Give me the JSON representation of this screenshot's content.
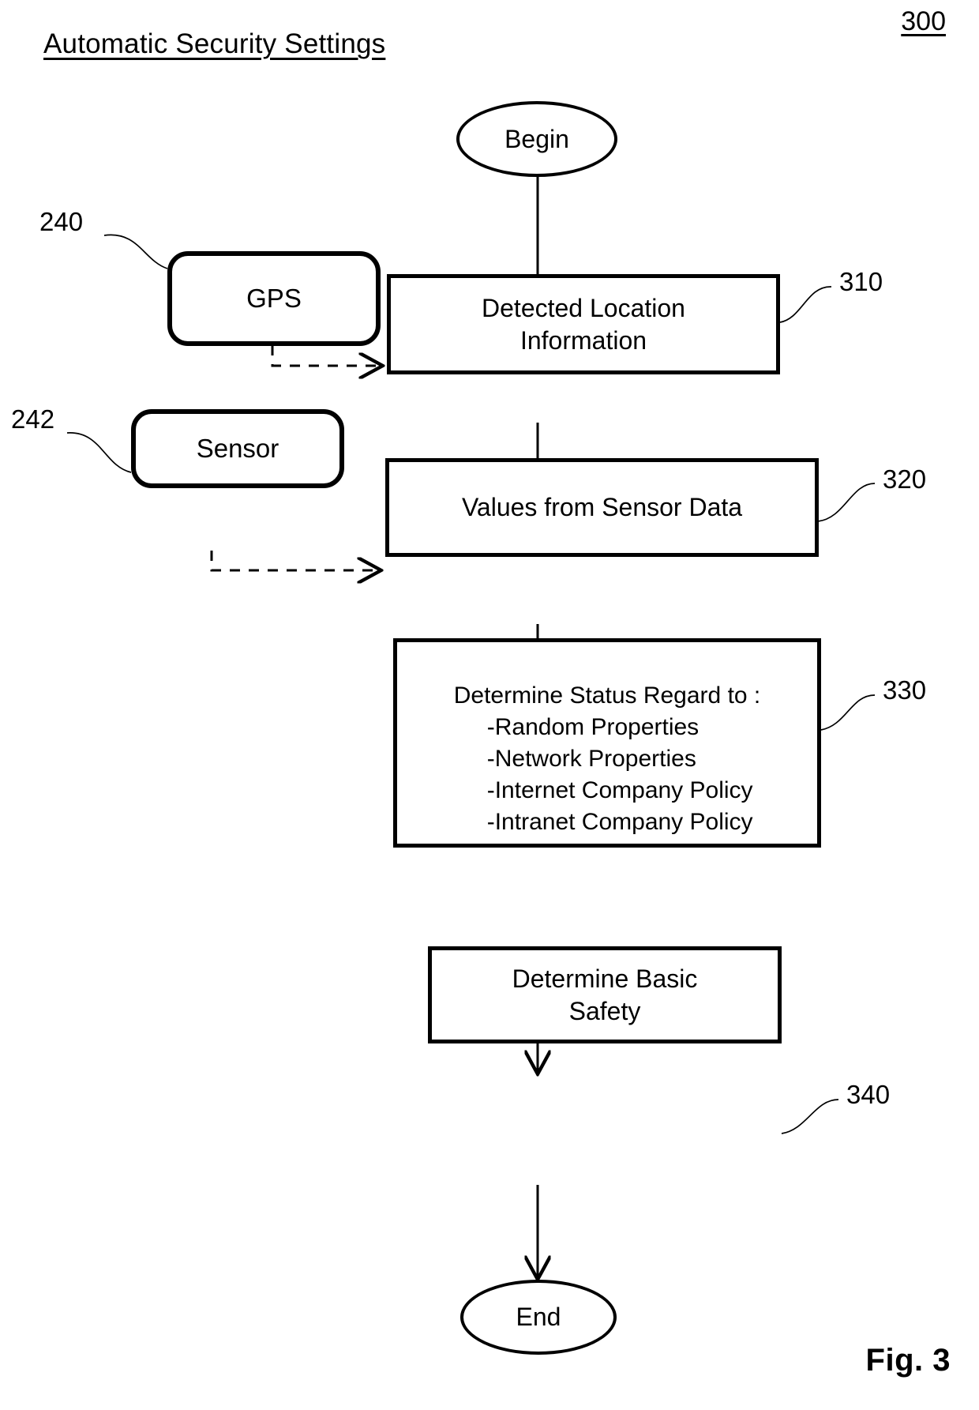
{
  "figure": {
    "title": "Automatic Security Settings",
    "top_reference": "300",
    "caption": "Fig. 3"
  },
  "nodes": {
    "begin": {
      "label": "Begin",
      "ref": ""
    },
    "gps": {
      "label": "GPS",
      "ref": "240"
    },
    "sensor": {
      "label": "Sensor",
      "ref": "242"
    },
    "step310": {
      "line1": "Detected Location",
      "line2": "Information",
      "ref": "310"
    },
    "step320": {
      "label": "Values from Sensor Data",
      "ref": "320"
    },
    "step330": {
      "heading": "Determine Status Regard to :",
      "items": [
        "-Random Properties",
        "-Network Properties",
        "-Internet Company Policy",
        "-Intranet Company Policy"
      ],
      "ref": "330"
    },
    "step340": {
      "line1": "Determine Basic",
      "line2": "Safety",
      "ref": "340"
    },
    "end": {
      "label": "End",
      "ref": ""
    }
  },
  "colors": {
    "stroke": "#000000",
    "background": "#ffffff"
  }
}
